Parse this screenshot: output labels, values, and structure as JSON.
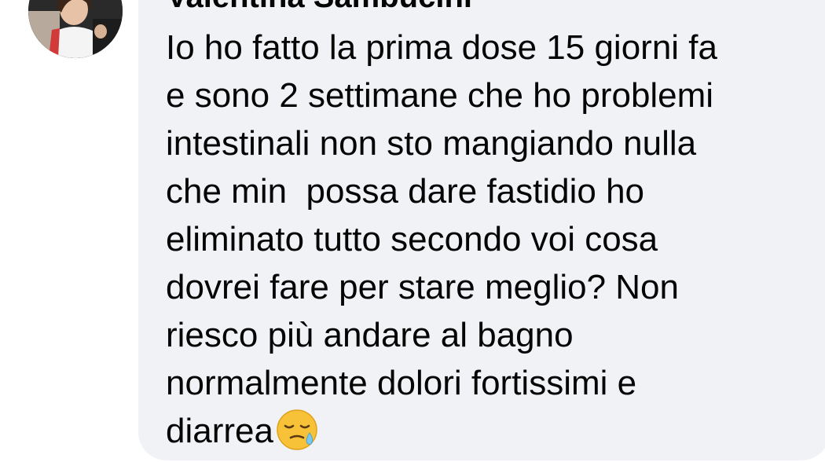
{
  "comment": {
    "author_name": "Valentina Sambucini",
    "avatar_icon": "profile-photo",
    "lines": [
      "Io ho fatto la prima dose 15 giorni fa",
      "e sono 2 settimane che ho problemi",
      "intestinali non sto mangiando nulla",
      "che min  possa dare fastidio ho",
      "eliminato tutto secondo voi cosa",
      "dovrei fare per stare meglio? Non",
      "riesco più andare al bagno",
      "normalmente dolori fortissimi e",
      "diarrea"
    ],
    "trailing_emoji": "sleepy-face-emoji"
  },
  "colors": {
    "bubble_background": "#f0f2f5",
    "text": "#050505",
    "page_background": "#ffffff"
  }
}
